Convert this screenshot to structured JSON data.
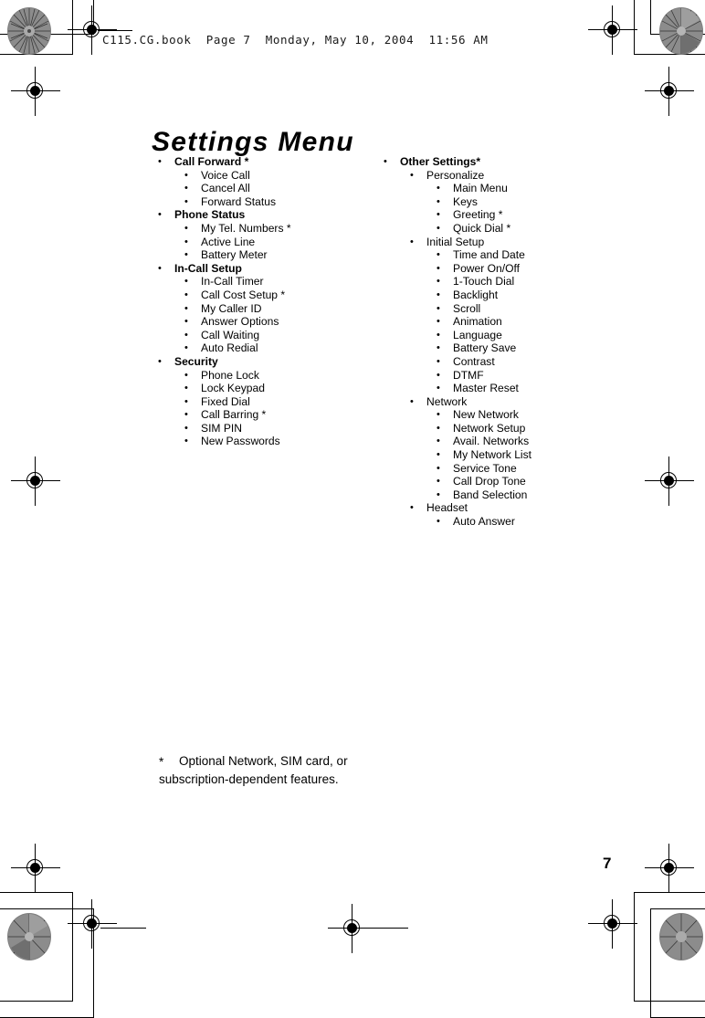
{
  "header": {
    "slug": "C115.CG.book  Page 7  Monday, May 10, 2004  11:56 AM"
  },
  "page": {
    "title": "Settings Menu",
    "number": "7"
  },
  "bullet_glyph": "•",
  "columns": {
    "left": [
      {
        "level": 1,
        "label": "Call Forward *"
      },
      {
        "level": 2,
        "label": "Voice Call"
      },
      {
        "level": 2,
        "label": "Cancel All"
      },
      {
        "level": 2,
        "label": "Forward Status"
      },
      {
        "level": 1,
        "label": "Phone Status"
      },
      {
        "level": 2,
        "label": "My Tel. Numbers *"
      },
      {
        "level": 2,
        "label": "Active Line"
      },
      {
        "level": 2,
        "label": "Battery Meter"
      },
      {
        "level": 1,
        "label": "In-Call Setup"
      },
      {
        "level": 2,
        "label": "In-Call Timer"
      },
      {
        "level": 2,
        "label": "Call Cost Setup *"
      },
      {
        "level": 2,
        "label": "My Caller ID"
      },
      {
        "level": 2,
        "label": "Answer Options"
      },
      {
        "level": 2,
        "label": "Call Waiting"
      },
      {
        "level": 2,
        "label": "Auto Redial"
      },
      {
        "level": 1,
        "label": "Security"
      },
      {
        "level": 2,
        "label": "Phone Lock"
      },
      {
        "level": 2,
        "label": "Lock Keypad"
      },
      {
        "level": 2,
        "label": "Fixed Dial"
      },
      {
        "level": 2,
        "label": "Call Barring *"
      },
      {
        "level": 2,
        "label": "SIM PIN"
      },
      {
        "level": 2,
        "label": "New Passwords"
      }
    ],
    "right": [
      {
        "level": 1,
        "label": "Other Settings*"
      },
      {
        "level": 2,
        "label": "Personalize"
      },
      {
        "level": 3,
        "label": "Main Menu"
      },
      {
        "level": 3,
        "label": "Keys"
      },
      {
        "level": 3,
        "label": "Greeting *"
      },
      {
        "level": 3,
        "label": "Quick Dial *"
      },
      {
        "level": 2,
        "label": "Initial Setup"
      },
      {
        "level": 3,
        "label": "Time and Date"
      },
      {
        "level": 3,
        "label": "Power On/Off"
      },
      {
        "level": 3,
        "label": "1-Touch Dial"
      },
      {
        "level": 3,
        "label": "Backlight"
      },
      {
        "level": 3,
        "label": "Scroll"
      },
      {
        "level": 3,
        "label": "Animation"
      },
      {
        "level": 3,
        "label": "Language"
      },
      {
        "level": 3,
        "label": "Battery Save"
      },
      {
        "level": 3,
        "label": "Contrast"
      },
      {
        "level": 3,
        "label": "DTMF"
      },
      {
        "level": 3,
        "label": "Master Reset"
      },
      {
        "level": 2,
        "label": "Network"
      },
      {
        "level": 3,
        "label": "New Network"
      },
      {
        "level": 3,
        "label": "Network Setup"
      },
      {
        "level": 3,
        "label": "Avail. Networks"
      },
      {
        "level": 3,
        "label": "My Network List"
      },
      {
        "level": 3,
        "label": "Service Tone"
      },
      {
        "level": 3,
        "label": "Call Drop Tone"
      },
      {
        "level": 3,
        "label": "Band Selection"
      },
      {
        "level": 2,
        "label": "Headset"
      },
      {
        "level": 3,
        "label": "Auto Answer"
      }
    ]
  },
  "footnote": {
    "marker": "*",
    "text": "Optional Network, SIM card, or subscription-dependent features."
  }
}
